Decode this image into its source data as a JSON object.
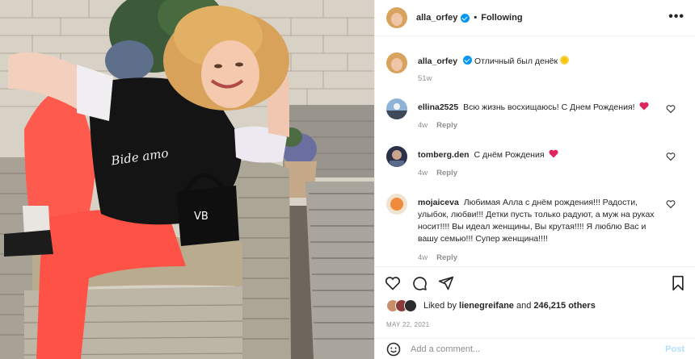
{
  "post": {
    "photo_alt": "",
    "shirt_text": "Віdе ато",
    "bag_text": "VВ"
  },
  "header": {
    "username": "alla_orfey",
    "separator": "•",
    "follow_label": "Following",
    "more_icon": "ellipsis-icon",
    "more_label": "•••"
  },
  "caption": {
    "username": "alla_orfey",
    "text": "Отличный был денёк",
    "emoji": "sun-emoji",
    "time": "51w"
  },
  "comments": [
    {
      "username": "ellina2525",
      "text": "Всю жизнь восхищаюсь! С Днем Рождения!",
      "emoji": "heart-emoji",
      "time": "4w",
      "reply_label": "Reply"
    },
    {
      "username": "tomberg.den",
      "text": "С днём Рождения",
      "emoji": "heart-emoji",
      "time": "4w",
      "reply_label": "Reply"
    },
    {
      "username": "mojaiceva",
      "text": "Любимая Алла с днём рождения!!! Радости, улыбок, любви!!! Детки пусть только радуют, а муж на руках носит!!!! Вы идеал женщины, Вы крутая!!!! Я люблю Вас и вашу семью!!! Супер женщина!!!!",
      "emoji": "",
      "time": "4w",
      "reply_label": "Reply"
    }
  ],
  "actions": {
    "like_icon": "heart-outline-icon",
    "comment_icon": "comment-icon",
    "share_icon": "share-icon",
    "save_icon": "bookmark-icon"
  },
  "likes": {
    "prefix": "Liked by",
    "first_user": "lienegreifane",
    "connector": "and",
    "others_count": "246,215 others"
  },
  "date": "MAY 22, 2021",
  "add_comment": {
    "emoji_icon": "smiley-icon",
    "placeholder": "Add a comment...",
    "post_label": "Post"
  },
  "colors": {
    "accent": "#0095f6",
    "post_disabled": "#b2dffc",
    "heart": "#ed4956",
    "muted": "#8e8e8e"
  }
}
